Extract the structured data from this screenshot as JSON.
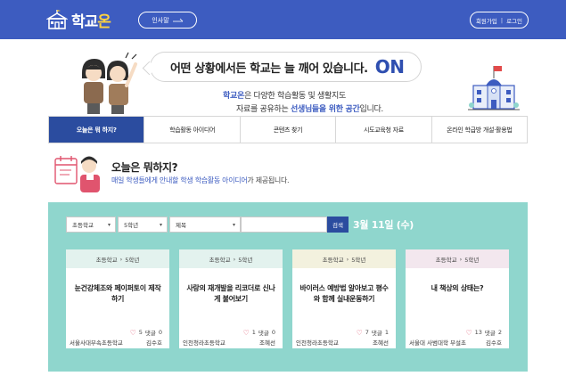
{
  "header": {
    "logo_text_1": "학교",
    "logo_text_2": "온",
    "greet_label": "인사말",
    "signup_label": "회원가입",
    "login_label": "로그인",
    "bg_color": "#3d5cc0"
  },
  "hero": {
    "speech_text": "어떤 상황에서든 학교는 늘 깨어 있습니다.",
    "speech_on": "ON",
    "line1_brand": "학교온",
    "line1_rest": "은 다양한 학습활동 및 생활지도",
    "line2_start": "자료를 공유하는 ",
    "line2_highlight": "선생님들을 위한 공간",
    "line2_end": "입니다."
  },
  "nav": {
    "tabs": [
      {
        "label": "오늘은 뭐 하지?",
        "active": true
      },
      {
        "label": "학습활동 아이디어",
        "active": false
      },
      {
        "label": "콘텐츠 찾기",
        "active": false
      },
      {
        "label": "시도교육청 자료",
        "active": false
      },
      {
        "label": "온라인 학급방 개설·활용법",
        "active": false
      }
    ]
  },
  "section": {
    "title": "오늘은 뭐하지?",
    "desc_1": "매일 학생들에게 안내할 학생 학습활동 아이디어",
    "desc_2": "가 제공됩니다."
  },
  "filters": {
    "level": "초등학교",
    "grade": "5학년",
    "field": "제목",
    "search_value": "",
    "search_label": "검색",
    "date": "3월 11일 (수)"
  },
  "cards": [
    {
      "level": "초등학교",
      "grade": "5학년",
      "title": "눈건강체조와 페이퍼토이 제작하기",
      "likes": "5",
      "comments_label": "댓글",
      "comments": "0",
      "school": "서울사대부속초등학교",
      "author": "김수호",
      "head_color": "#e3f2ee"
    },
    {
      "level": "초등학교",
      "grade": "5학년",
      "title": "사랑의 재개발을 리코더로 신나게 불어보기",
      "likes": "1",
      "comments_label": "댓글",
      "comments": "0",
      "school": "인천청라초등학교",
      "author": "조혜선",
      "head_color": "#e3f2ee"
    },
    {
      "level": "초등학교",
      "grade": "5학년",
      "title": "바이러스 예방법 알아보고 평수와 함께 실내운동하기",
      "likes": "7",
      "comments_label": "댓글",
      "comments": "1",
      "school": "인천청라초등학교",
      "author": "조혜선",
      "head_color": "#f3f1de"
    },
    {
      "level": "초등학교",
      "grade": "5학년",
      "title": "내 책상의 상태는?",
      "likes": "13",
      "comments_label": "댓글",
      "comments": "2",
      "school": "서울대 사범대학 부설초",
      "author": "김수호",
      "head_color": "#f3e7ee"
    }
  ],
  "colors": {
    "accent_blue": "#2b4c9f",
    "panel_teal": "#8fd6cd",
    "heart_red": "#e0546e"
  },
  "icons": {
    "logo": "school-building-icon",
    "arrow": "arrow-right-icon",
    "chevron": "chevron-right-icon",
    "heart": "heart-icon",
    "dropdown": "chevron-down-icon"
  }
}
